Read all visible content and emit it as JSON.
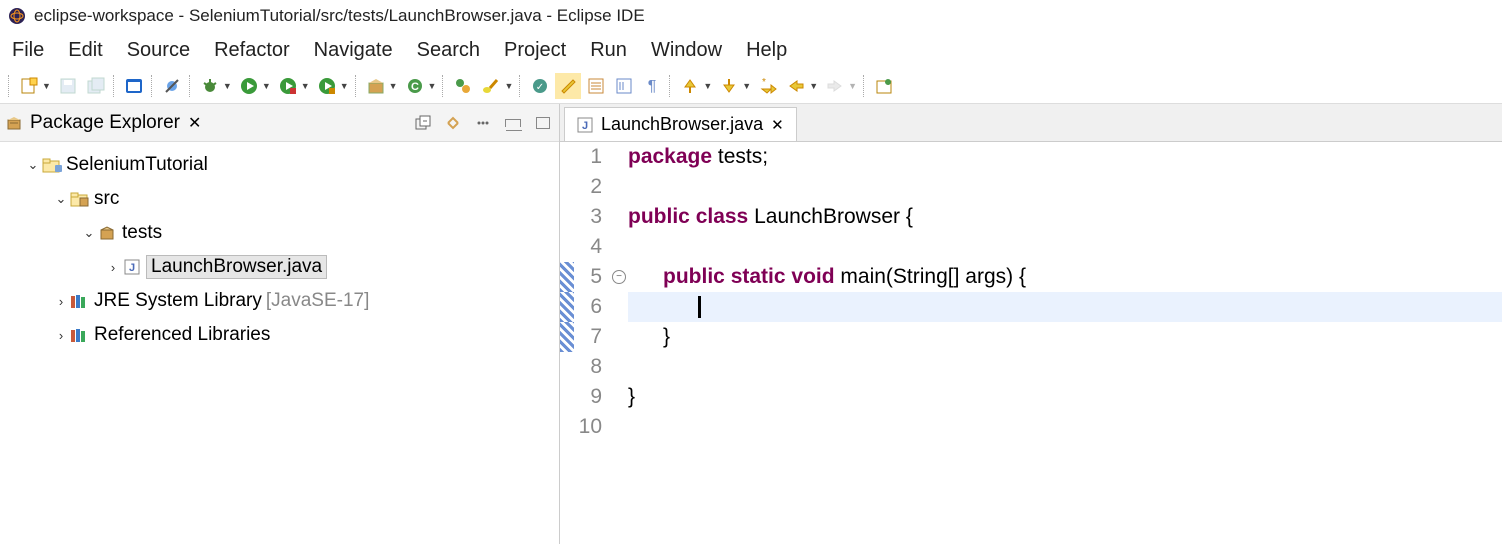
{
  "window": {
    "title": "eclipse-workspace - SeleniumTutorial/src/tests/LaunchBrowser.java - Eclipse IDE"
  },
  "menu": {
    "items": [
      "File",
      "Edit",
      "Source",
      "Refactor",
      "Navigate",
      "Search",
      "Project",
      "Run",
      "Window",
      "Help"
    ]
  },
  "explorer": {
    "title": "Package Explorer",
    "tree": {
      "project": "SeleniumTutorial",
      "src": "src",
      "pkg": "tests",
      "file": "LaunchBrowser.java",
      "jre_label": "JRE System Library",
      "jre_env": "[JavaSE-17]",
      "ref_libs": "Referenced Libraries"
    }
  },
  "editor": {
    "tab_label": "LaunchBrowser.java",
    "lines": {
      "l1_kw": "package",
      "l1_rest": " tests;",
      "l3_kw1": "public",
      "l3_kw2": "class",
      "l3_rest": " LaunchBrowser {",
      "l5_kw1": "public",
      "l5_kw2": "static",
      "l5_kw3": "void",
      "l5_rest": " main(String[] args) {",
      "l7": "      }",
      "l9": "}",
      "nums": [
        "1",
        "2",
        "3",
        "4",
        "5",
        "6",
        "7",
        "8",
        "9",
        "10"
      ]
    }
  }
}
